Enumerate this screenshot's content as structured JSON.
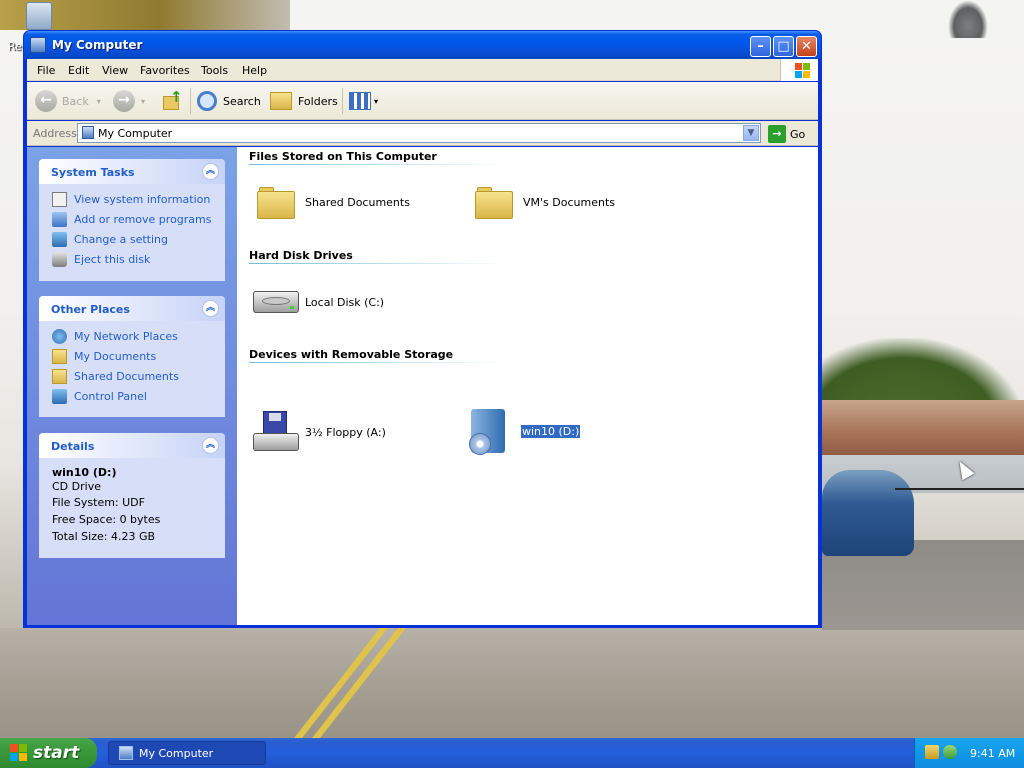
{
  "desktop": {
    "recycle_bin_label": "Re"
  },
  "window": {
    "title": "My Computer",
    "menu": [
      "File",
      "Edit",
      "View",
      "Favorites",
      "Tools",
      "Help"
    ],
    "toolbar": {
      "back": "Back",
      "search": "Search",
      "folders": "Folders"
    },
    "address": {
      "label": "Address",
      "value": "My Computer",
      "go": "Go"
    }
  },
  "left_pane": {
    "system_tasks": {
      "title": "System Tasks",
      "items": [
        "View system information",
        "Add or remove programs",
        "Change a setting",
        "Eject this disk"
      ]
    },
    "other_places": {
      "title": "Other Places",
      "items": [
        "My Network Places",
        "My Documents",
        "Shared Documents",
        "Control Panel"
      ]
    },
    "details": {
      "title": "Details",
      "name": "win10 (D:)",
      "type": "CD Drive",
      "file_system": "File System: UDF",
      "free_space": "Free Space: 0 bytes",
      "total_size": "Total Size: 4.23 GB"
    }
  },
  "content": {
    "groups": [
      {
        "title": "Files Stored on This Computer",
        "items": [
          "Shared Documents",
          "VM's Documents"
        ]
      },
      {
        "title": "Hard Disk Drives",
        "items": [
          "Local Disk (C:)"
        ]
      },
      {
        "title": "Devices with Removable Storage",
        "items": [
          "3½ Floppy (A:)",
          "win10 (D:)"
        ]
      }
    ],
    "selected_item": "win10 (D:)"
  },
  "taskbar": {
    "start": "start",
    "task_button": "My Computer",
    "clock": "9:41 AM"
  },
  "colors": {
    "accent": "#215dc6",
    "selection": "#316ac5",
    "titlebar": "#0058ee",
    "start": "#3a9a3a"
  }
}
